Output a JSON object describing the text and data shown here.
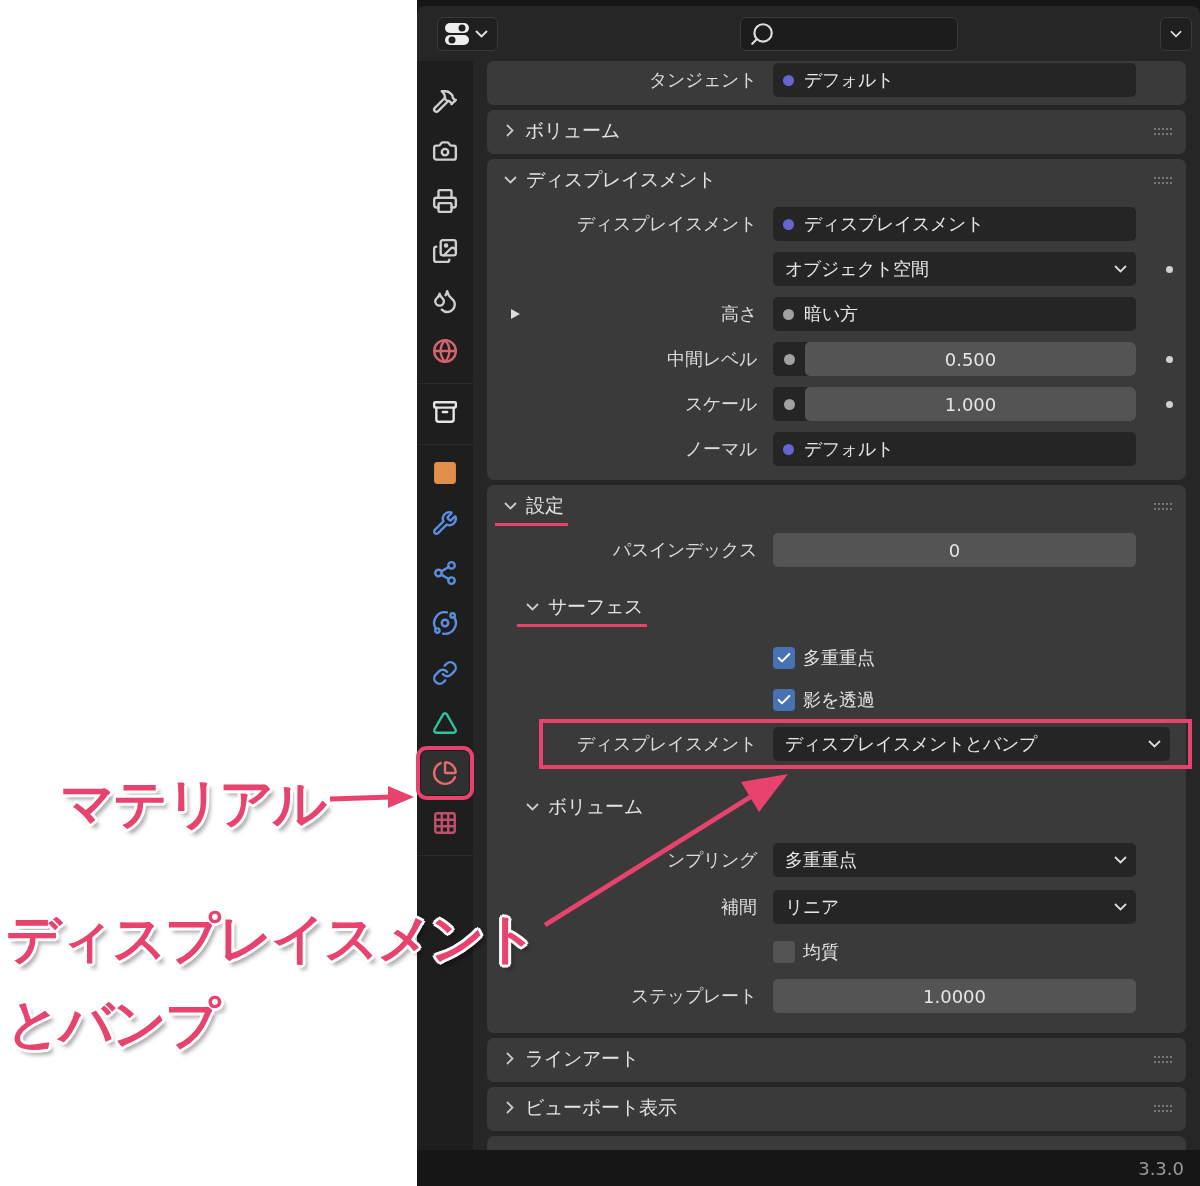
{
  "sidebar": {
    "groups": [
      [
        {
          "selected": false,
          "highlighted": false
        },
        {
          "selected": false,
          "highlighted": false
        },
        {
          "selected": false,
          "highlighted": false
        },
        {
          "selected": false,
          "highlighted": false
        },
        {
          "selected": false,
          "highlighted": false
        },
        {
          "selected": false,
          "highlighted": false
        }
      ],
      [
        {
          "selected": false,
          "highlighted": false
        }
      ],
      [
        {
          "selected": false,
          "highlighted": false
        },
        {
          "selected": false,
          "highlighted": false
        },
        {
          "selected": false,
          "highlighted": false
        },
        {
          "selected": false,
          "highlighted": false
        },
        {
          "selected": false,
          "highlighted": false
        },
        {
          "selected": false,
          "highlighted": false
        },
        {
          "selected": true,
          "highlighted": true
        },
        {
          "selected": false,
          "highlighted": false
        }
      ]
    ]
  },
  "panels": [
    {
      "rows": [
        {
          "kind": "socket",
          "label": "タンジェント",
          "value": "デフォルト",
          "color": "#6464d2"
        }
      ]
    },
    {
      "title": "ボリューム",
      "expanded": false,
      "underlined": false
    },
    {
      "title": "ディスプレイスメント",
      "expanded": true,
      "underlined": false,
      "rows": [
        {
          "kind": "socket",
          "label": "ディスプレイスメント",
          "value": "ディスプレイスメント",
          "color": "#6464d2"
        },
        {
          "kind": "dropdown",
          "value": "オブジェクト空間",
          "keyframe_dot": true
        },
        {
          "kind": "socket",
          "label": "高さ",
          "value": "暗い方",
          "color": "#a1a1a1",
          "expandable": true
        },
        {
          "kind": "socket_number",
          "label": "中間レベル",
          "value": "0.500",
          "color": "#a1a1a1",
          "keyframe_dot": true
        },
        {
          "kind": "socket_number",
          "label": "スケール",
          "value": "1.000",
          "color": "#a1a1a1",
          "keyframe_dot": true
        },
        {
          "kind": "socket",
          "label": "ノーマル",
          "value": "デフォルト",
          "color": "#6464d2"
        }
      ]
    },
    {
      "title": "設定",
      "expanded": true,
      "underlined": true,
      "rows": [
        {
          "kind": "number",
          "label": "パスインデックス",
          "value": "0"
        },
        {
          "kind": "subpanel",
          "title": "サーフェス",
          "expanded": true,
          "underlined": true,
          "rows": [
            {
              "kind": "checkbox",
              "label": "多重重点",
              "checked": true
            },
            {
              "kind": "checkbox",
              "label": "影を透過",
              "checked": true
            },
            {
              "kind": "dropdown",
              "label": "ディスプレイスメント",
              "value": "ディスプレイスメントとバンプ",
              "highlighted": true
            }
          ]
        },
        {
          "kind": "subpanel",
          "title": "ボリューム",
          "expanded": true,
          "underlined": false,
          "rows": [
            {
              "kind": "dropdown",
              "label": "ンプリング",
              "value": "多重重点"
            },
            {
              "kind": "dropdown",
              "label": "補間",
              "value": "リニア"
            },
            {
              "kind": "checkbox",
              "label": "均質",
              "checked": false
            },
            {
              "kind": "number",
              "label": "ステップレート",
              "value": "1.0000"
            }
          ]
        }
      ]
    },
    {
      "title": "ラインアート",
      "expanded": false,
      "underlined": false
    },
    {
      "title": "ビューポート表示",
      "expanded": false,
      "underlined": false
    }
  ],
  "version": "3.3.0",
  "annotations": [
    {
      "text": "マテリアル"
    },
    {
      "text": "ディスプレイスメント"
    },
    {
      "text": "とバンプ"
    }
  ]
}
